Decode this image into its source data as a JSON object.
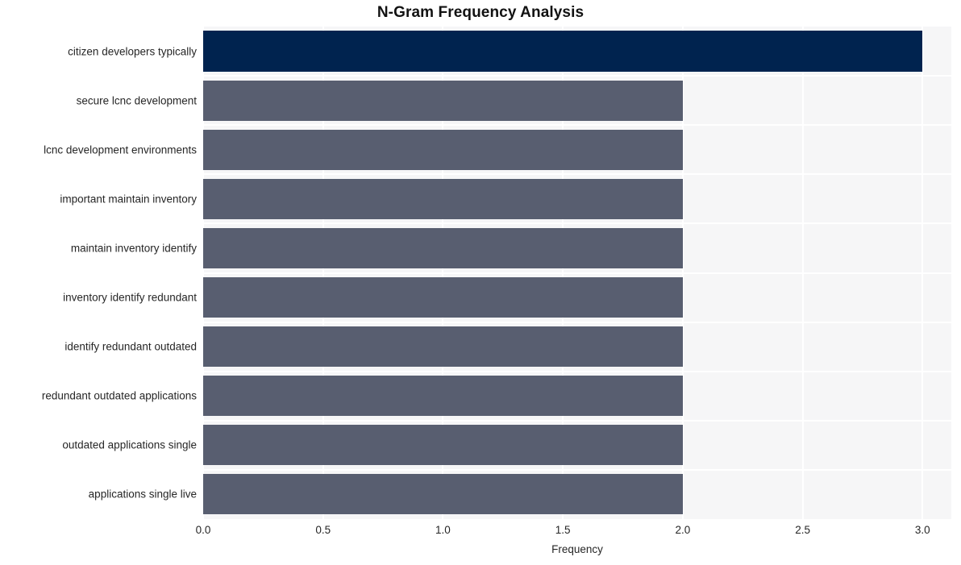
{
  "chart_data": {
    "type": "bar",
    "orientation": "horizontal",
    "title": "N-Gram Frequency Analysis",
    "xlabel": "Frequency",
    "ylabel": "",
    "categories": [
      "citizen developers typically",
      "secure lcnc development",
      "lcnc development environments",
      "important maintain inventory",
      "maintain inventory identify",
      "inventory identify redundant",
      "identify redundant outdated",
      "redundant outdated applications",
      "outdated applications single",
      "applications single live"
    ],
    "values": [
      3,
      2,
      2,
      2,
      2,
      2,
      2,
      2,
      2,
      2
    ],
    "xlim": [
      0,
      3.12
    ],
    "xticks": [
      0.0,
      0.5,
      1.0,
      1.5,
      2.0,
      2.5,
      3.0
    ],
    "xticklabels": [
      "0.0",
      "0.5",
      "1.0",
      "1.5",
      "2.0",
      "2.5",
      "3.0"
    ],
    "grid": true,
    "grid_axis": "both",
    "legend": "none",
    "bar_colors": [
      "#00234f",
      "#585e70",
      "#585e70",
      "#585e70",
      "#585e70",
      "#585e70",
      "#585e70",
      "#585e70",
      "#585e70",
      "#585e70"
    ],
    "colors": {
      "highlight": "#00234f",
      "bar": "#585e70",
      "plot_background": "#f6f6f7",
      "gridline": "#ffffff",
      "figure_background": "#ffffff",
      "text": "#262626",
      "title": "#121212"
    }
  }
}
